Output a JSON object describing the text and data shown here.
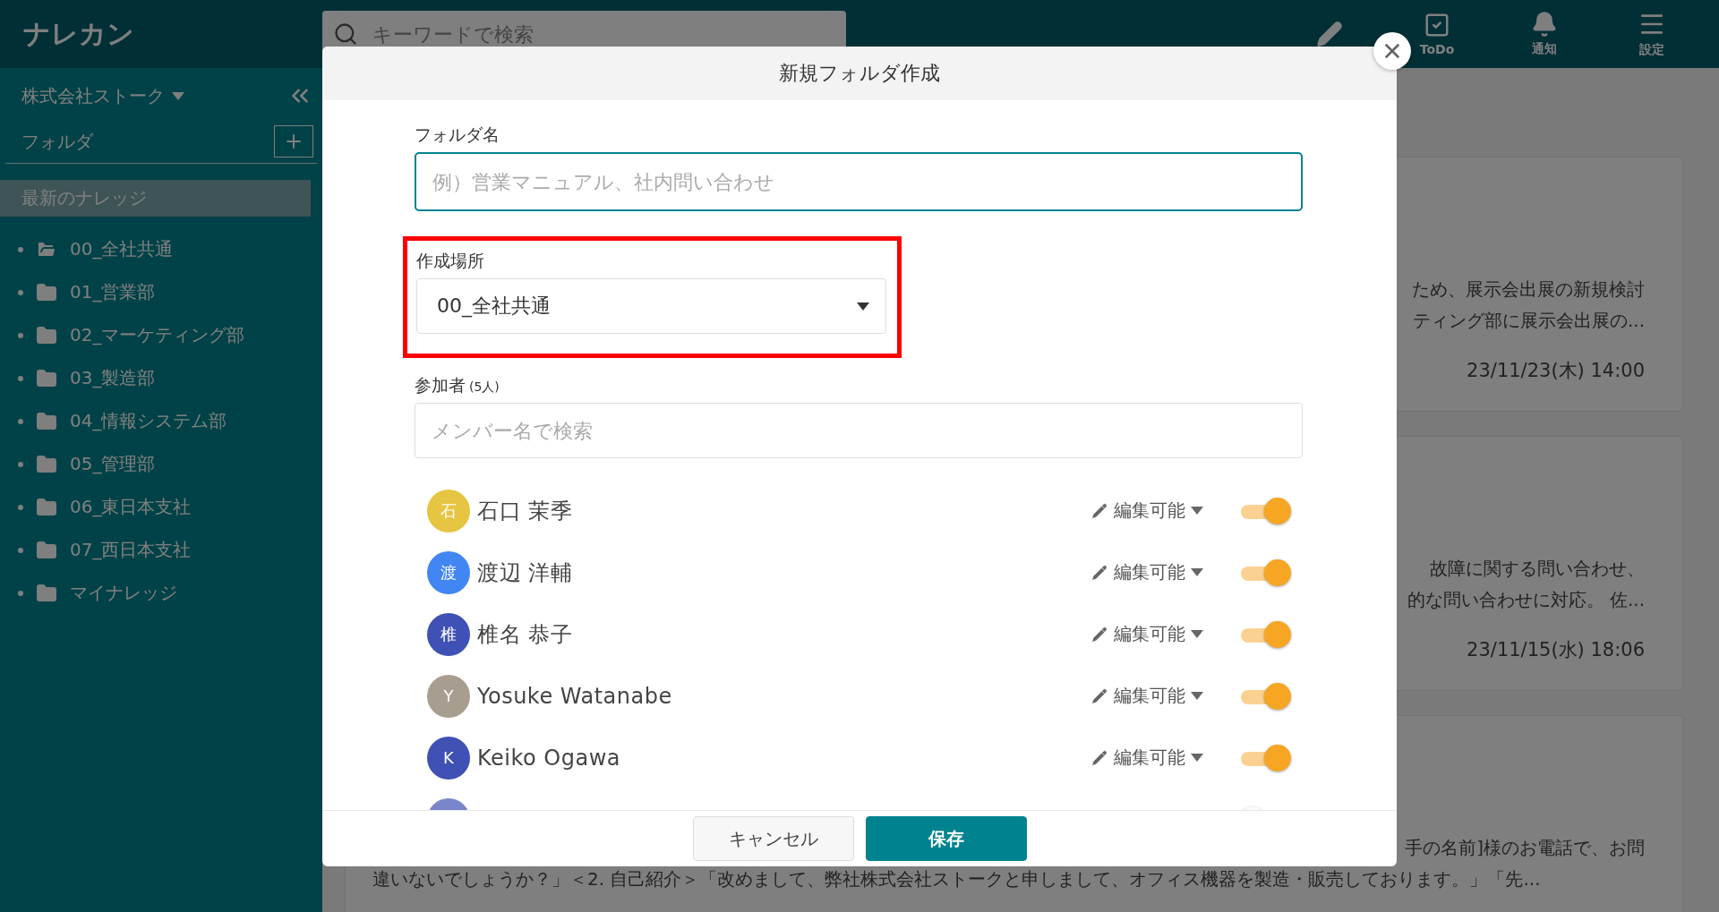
{
  "app": {
    "logo": "ナレカン",
    "search_placeholder": "キーワードで検索"
  },
  "header_actions": [
    {
      "kind": "pencil"
    },
    {
      "kind": "todo",
      "label": "ToDo"
    },
    {
      "kind": "bell",
      "label": "通知"
    },
    {
      "kind": "menu",
      "label": "設定"
    }
  ],
  "sidebar": {
    "company": "株式会社ストーク",
    "section": "フォルダ",
    "nav": [
      {
        "label": "最新のナレッジ",
        "selected": true
      }
    ],
    "folders": [
      {
        "label": "00_全社共通",
        "open": true
      },
      {
        "label": "01_営業部",
        "open": false
      },
      {
        "label": "02_マーケティング部",
        "open": false
      },
      {
        "label": "03_製造部",
        "open": false
      },
      {
        "label": "04_情報システム部",
        "open": false
      },
      {
        "label": "05_管理部",
        "open": false
      },
      {
        "label": "06_東日本支社",
        "open": false
      },
      {
        "label": "07_西日本支社",
        "open": false
      },
      {
        "label": "マイナレッジ",
        "open": false
      }
    ]
  },
  "knowledge_cards": [
    {
      "kind": "summary",
      "lines": [
        "ため、展示会出展の新規検討",
        "ティング部に展示会出展の..."
      ],
      "date": "23/11/23(木) 14:00"
    },
    {
      "kind": "summary",
      "lines": [
        "故障に関する問い合わせ、",
        "的な問い合わせに対応。 佐..."
      ],
      "date": "23/11/15(水) 18:06"
    },
    {
      "kind": "excerpt",
      "lines": [
        "手の名前]様のお電話で、お問",
        "違いないでしょうか？」＜2. 自己紹介＞「改めまして、弊社株式会社ストークと申しまして、オフィス機器を製造・販売しております。」「先..."
      ]
    }
  ],
  "dialog": {
    "title": "新規フォルダ作成",
    "folder_name": {
      "label": "フォルダ名",
      "placeholder": "例）営業マニュアル、社内問い合わせ"
    },
    "location": {
      "label": "作成場所",
      "value": "00_全社共通",
      "highlighted": true
    },
    "participants": {
      "label": "参加者",
      "count": "(5人)",
      "search_placeholder": "メンバー名で検索"
    },
    "members": [
      {
        "kind": "full",
        "initial": "石",
        "name": "石口 茉季",
        "color": "#e5c541",
        "permission": "編集可能",
        "on": true
      },
      {
        "kind": "full",
        "initial": "渡",
        "name": "渡辺 洋輔",
        "color": "#4286f4",
        "permission": "編集可能",
        "on": true
      },
      {
        "kind": "full",
        "initial": "椎",
        "name": "椎名 恭子",
        "color": "#3f51b5",
        "permission": "編集可能",
        "on": true
      },
      {
        "kind": "full",
        "initial": "Y",
        "name": "Yosuke Watanabe",
        "color": "#a89e8f",
        "permission": "編集可能",
        "on": true
      },
      {
        "kind": "full",
        "initial": "K",
        "name": "Keiko Ogawa",
        "color": "#3f51b5",
        "permission": "編集可能",
        "on": true
      },
      {
        "kind": "partial",
        "color": "#7986cb",
        "on": false
      }
    ],
    "buttons": [
      {
        "kind": "cancel",
        "label": "キャンセル"
      },
      {
        "kind": "save",
        "label": "保存"
      }
    ]
  }
}
